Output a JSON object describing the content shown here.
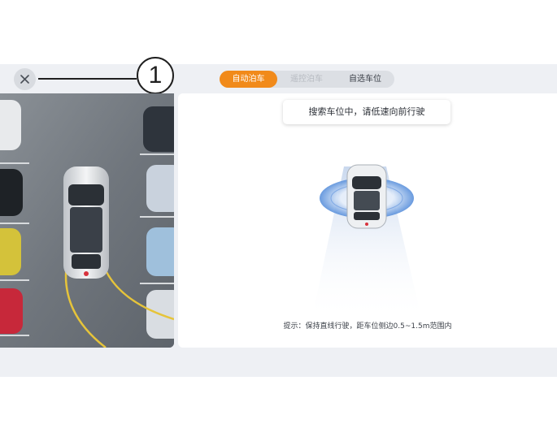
{
  "callout": {
    "number": "1"
  },
  "header": {
    "close_icon": "close-icon",
    "tabs": [
      {
        "label": "自动泊车",
        "state": "active"
      },
      {
        "label": "遥控泊车",
        "state": "disabled"
      },
      {
        "label": "自选车位",
        "state": "normal"
      }
    ]
  },
  "main": {
    "banner": "搜索车位中，请低速向前行驶",
    "hint": "提示：保持直线行驶，距车位侧边0.5~1.5m范围内"
  },
  "colors": {
    "accent": "#f18a1a",
    "radar": "#3f7fd8",
    "path": "#e6c43a"
  }
}
